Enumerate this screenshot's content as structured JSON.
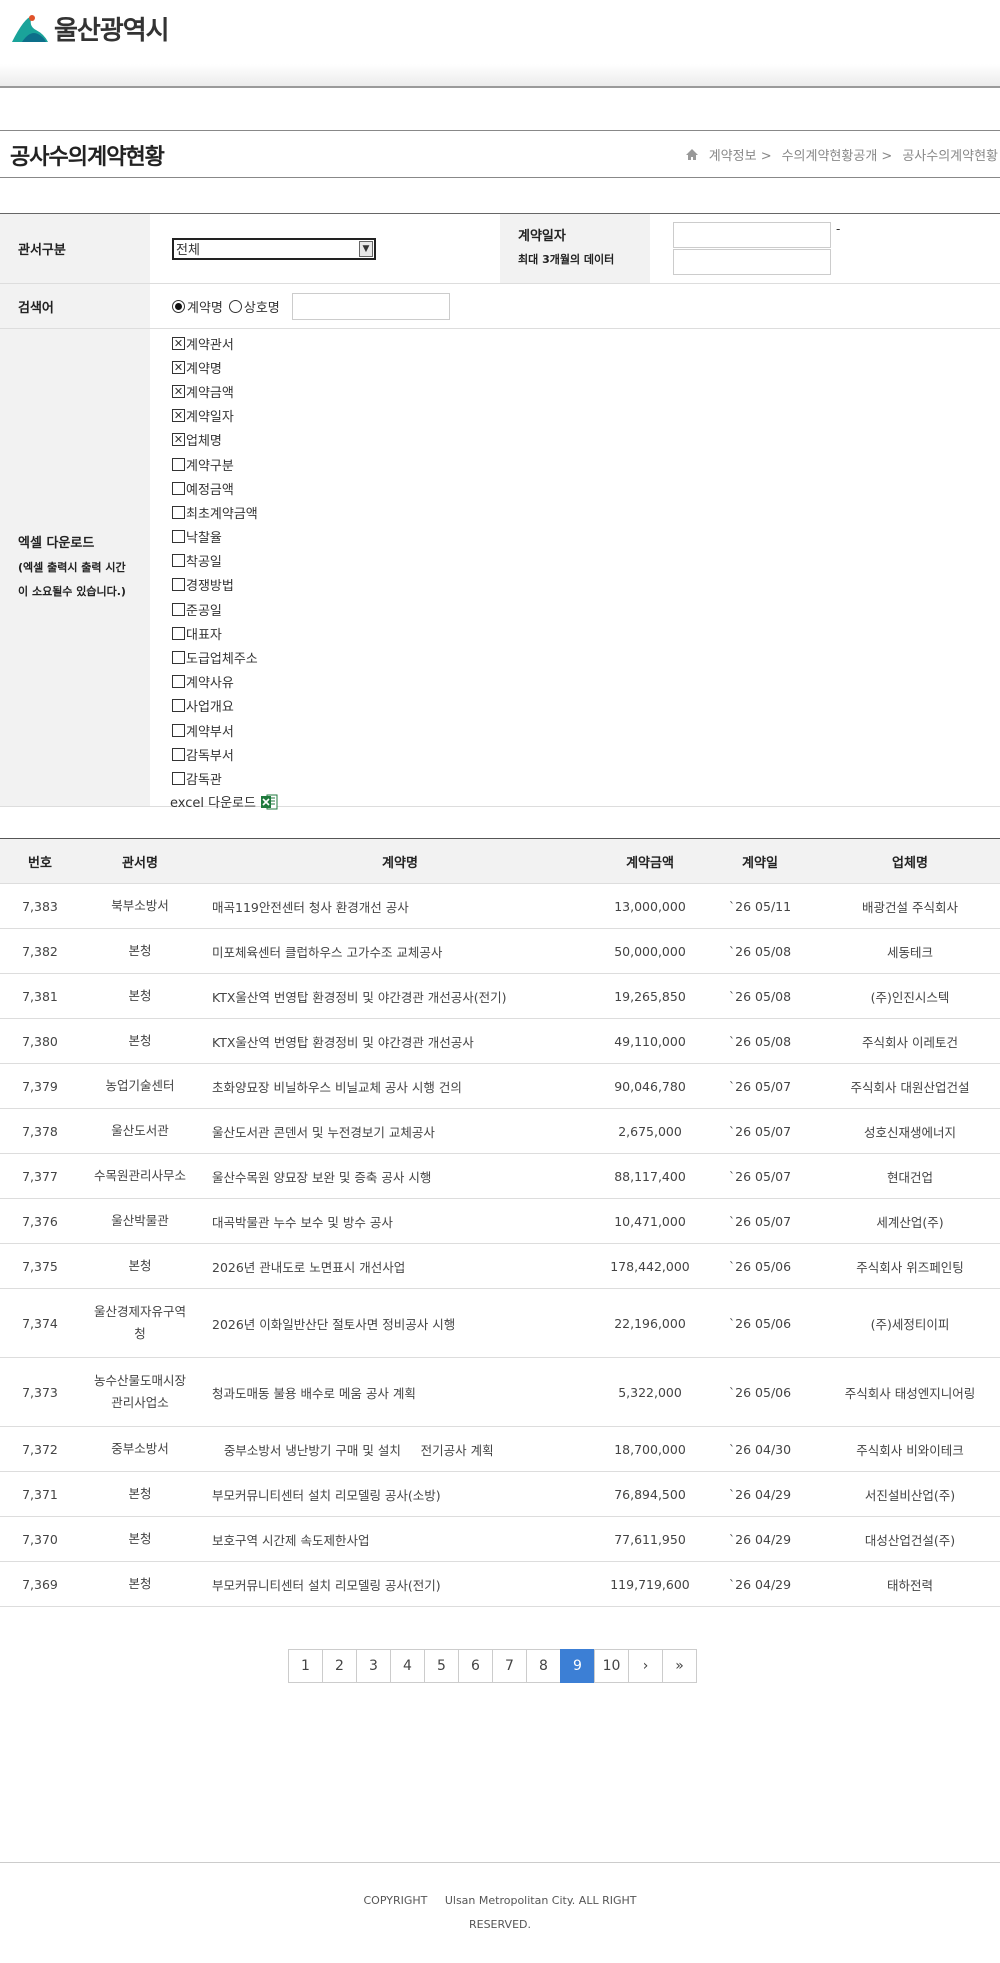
{
  "header": {
    "logo_text": "울산광역시"
  },
  "title": {
    "page_title": "공사수의계약현황",
    "breadcrumb": [
      "계약정보 >",
      "수의계약현황공개 >",
      "공사수의계약현황"
    ]
  },
  "search": {
    "office_label": "관서구분",
    "office_value": "전체",
    "date_label": "계약일자",
    "date_note": "최대 3개월의 데이터",
    "date_sep": "-",
    "keyword_label": "검색어",
    "radio_contract": "계약명",
    "radio_company": "상호명",
    "excel_label": "엑셀 다운로드",
    "excel_note": "(엑셀 출력시 출력 시간이 소요될수 있습니다.)",
    "excel_note_line1": "(엑셀 출력시 출력 시간",
    "excel_note_line2": "이 소요될수 있습니다.)",
    "excel_download": "excel 다운로드",
    "checkboxes": [
      {
        "label": "계약관서",
        "checked": true
      },
      {
        "label": "계약명",
        "checked": true
      },
      {
        "label": "계약금액",
        "checked": true
      },
      {
        "label": "계약일자",
        "checked": true
      },
      {
        "label": "업체명",
        "checked": true
      },
      {
        "label": "계약구분",
        "checked": false
      },
      {
        "label": "예정금액",
        "checked": false
      },
      {
        "label": "최초계약금액",
        "checked": false
      },
      {
        "label": "낙찰율",
        "checked": false
      },
      {
        "label": "착공일",
        "checked": false
      },
      {
        "label": "경쟁방법",
        "checked": false
      },
      {
        "label": "준공일",
        "checked": false
      },
      {
        "label": "대표자",
        "checked": false
      },
      {
        "label": "도급업체주소",
        "checked": false
      },
      {
        "label": "계약사유",
        "checked": false
      },
      {
        "label": "사업개요",
        "checked": false
      },
      {
        "label": "계약부서",
        "checked": false
      },
      {
        "label": "감독부서",
        "checked": false
      },
      {
        "label": "감독관",
        "checked": false
      }
    ]
  },
  "table": {
    "headers": [
      "번호",
      "관서명",
      "계약명",
      "계약금액",
      "계약일",
      "업체명"
    ],
    "rows": [
      {
        "no": "7,383",
        "office": "북부소방서",
        "name": "매곡119안전센터 청사 환경개선 공사",
        "amount": "13,000,000",
        "date": "`26 05/11",
        "company": "배광건설 주식회사"
      },
      {
        "no": "7,382",
        "office": "본청",
        "name": "미포체육센터 클럽하우스 고가수조 교체공사",
        "amount": "50,000,000",
        "date": "`26 05/08",
        "company": "세동테크"
      },
      {
        "no": "7,381",
        "office": "본청",
        "name": "KTX울산역 번영탑 환경정비 및 야간경관 개선공사(전기)",
        "amount": "19,265,850",
        "date": "`26 05/08",
        "company": "(주)인진시스텍"
      },
      {
        "no": "7,380",
        "office": "본청",
        "name": "KTX울산역 번영탑 환경정비 및 야간경관 개선공사",
        "amount": "49,110,000",
        "date": "`26 05/08",
        "company": "주식회사 이레토건"
      },
      {
        "no": "7,379",
        "office": "농업기술센터",
        "name": "초화양묘장 비닐하우스 비닐교체 공사 시행 건의",
        "amount": "90,046,780",
        "date": "`26 05/07",
        "company": "주식회사 대원산업건설"
      },
      {
        "no": "7,378",
        "office": "울산도서관",
        "name": "울산도서관 콘덴서 및 누전경보기 교체공사",
        "amount": "2,675,000",
        "date": "`26 05/07",
        "company": "성호신재생에너지"
      },
      {
        "no": "7,377",
        "office": "수목원관리사무소",
        "name": "울산수목원 양묘장 보완 및 증축 공사 시행",
        "amount": "88,117,400",
        "date": "`26 05/07",
        "company": "현대건업"
      },
      {
        "no": "7,376",
        "office": "울산박물관",
        "name": "대곡박물관 누수 보수 및 방수 공사",
        "amount": "10,471,000",
        "date": "`26 05/07",
        "company": "세계산업(주)"
      },
      {
        "no": "7,375",
        "office": "본청",
        "name": "2026년 관내도로 노면표시 개선사업",
        "amount": "178,442,000",
        "date": "`26 05/06",
        "company": "주식회사 위즈페인팅"
      },
      {
        "no": "7,374",
        "office_line1": "울산경제자유구역",
        "office_line2": "청",
        "name": "2026년 이화일반산단 절토사면 정비공사 시행",
        "amount": "22,196,000",
        "date": "`26 05/06",
        "company": "(주)세정티이피"
      },
      {
        "no": "7,373",
        "office_line1": "농수산물도매시장",
        "office_line2": "관리사업소",
        "name": "청과도매동 불용 배수로 메움 공사 계획",
        "amount": "5,322,000",
        "date": "`26 05/06",
        "company": "주식회사 태성엔지니어링"
      },
      {
        "no": "7,372",
        "office": "중부소방서",
        "name": "   중부소방서 냉난방기 구매 및 설치     전기공사 계획",
        "amount": "18,700,000",
        "date": "`26 04/30",
        "company": "주식회사 비와이테크"
      },
      {
        "no": "7,371",
        "office": "본청",
        "name": "부모커뮤니티센터 설치 리모델링 공사(소방)",
        "amount": "76,894,500",
        "date": "`26 04/29",
        "company": "서진설비산업(주)"
      },
      {
        "no": "7,370",
        "office": "본청",
        "name": "보호구역 시간제 속도제한사업",
        "amount": "77,611,950",
        "date": "`26 04/29",
        "company": "대성산업건설(주)"
      },
      {
        "no": "7,369",
        "office": "본청",
        "name": "부모커뮤니티센터 설치 리모델링 공사(전기)",
        "amount": "119,719,600",
        "date": "`26 04/29",
        "company": "태하전력"
      }
    ]
  },
  "pagination": {
    "pages": [
      "1",
      "2",
      "3",
      "4",
      "5",
      "6",
      "7",
      "8",
      "9",
      "10"
    ],
    "current": "9",
    "next": "›",
    "last": "»"
  },
  "footer": {
    "line1": "COPYRIGHT     Ulsan Metropolitan City. ALL RIGHT",
    "line2": "RESERVED."
  },
  "colors": {
    "accent": "#3c7fd5",
    "header_bg": "#f2f2f2",
    "logo_teal": "#1aa39a"
  }
}
